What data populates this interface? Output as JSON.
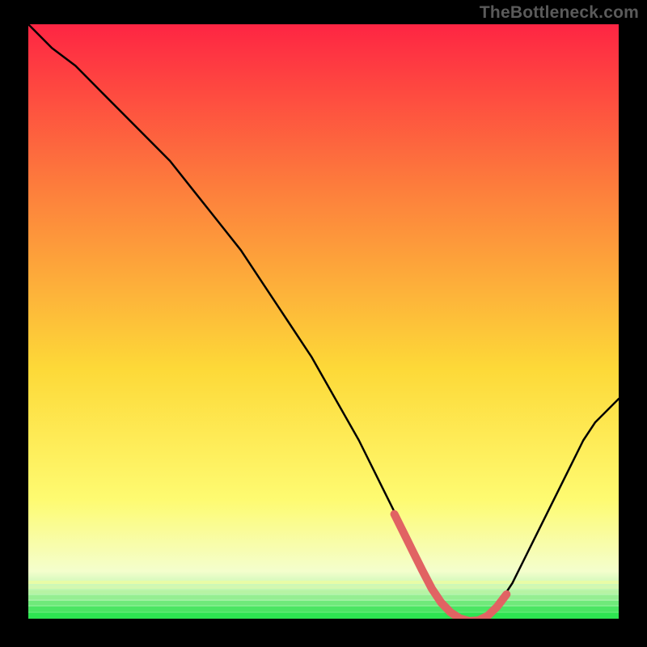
{
  "watermark": "TheBottleneck.com",
  "chart_data": {
    "type": "line",
    "title": "",
    "xlabel": "",
    "ylabel": "",
    "xlim": [
      0,
      100
    ],
    "ylim": [
      0,
      100
    ],
    "series": [
      {
        "name": "bottleneck-curve",
        "x": [
          0,
          4,
          8,
          12,
          16,
          20,
          24,
          28,
          32,
          36,
          40,
          44,
          48,
          52,
          56,
          60,
          62,
          64,
          66,
          68,
          70,
          72,
          74,
          76,
          78,
          80,
          82,
          84,
          86,
          88,
          90,
          92,
          94,
          96,
          98,
          100
        ],
        "values": [
          100,
          96,
          93,
          89,
          85,
          81,
          77,
          72,
          67,
          62,
          56,
          50,
          44,
          37,
          30,
          22,
          18,
          14,
          10,
          6,
          3,
          1,
          0,
          0,
          1,
          3,
          6,
          10,
          14,
          18,
          22,
          26,
          30,
          33,
          35,
          37
        ]
      }
    ],
    "optimal_range_x": [
      62,
      81
    ],
    "background_gradient": {
      "top": "#fe2543",
      "mid_top": "#fd7f3c",
      "mid": "#fdd938",
      "mid_bottom": "#fefb71",
      "bottom_band": "#f4fecd",
      "green": "#2de551"
    },
    "marker_color": "#e16363",
    "curve_color": "#000000"
  }
}
